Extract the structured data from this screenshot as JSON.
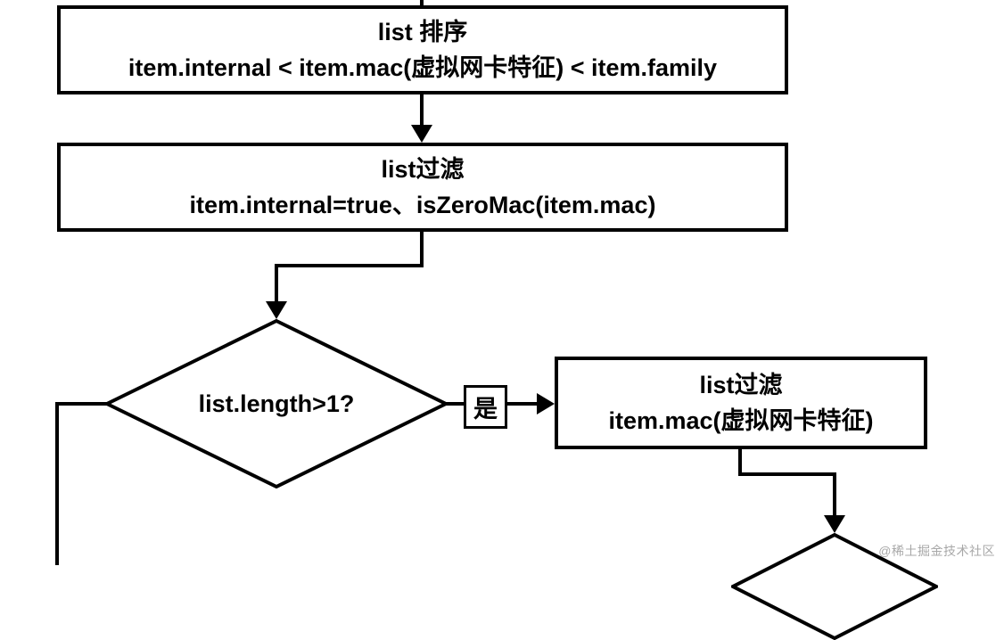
{
  "nodes": {
    "sort": {
      "title": "list 排序",
      "detail": "item.internal < item.mac(虚拟网卡特征) < item.family"
    },
    "filter1": {
      "title": "list过滤",
      "detail": "item.internal=true、isZeroMac(item.mac)"
    },
    "decision1": {
      "label": "list.length>1?"
    },
    "filter2": {
      "title": "list过滤",
      "detail": "item.mac(虚拟网卡特征)"
    }
  },
  "edges": {
    "yes": "是"
  },
  "watermark": "@稀土掘金技术社区"
}
